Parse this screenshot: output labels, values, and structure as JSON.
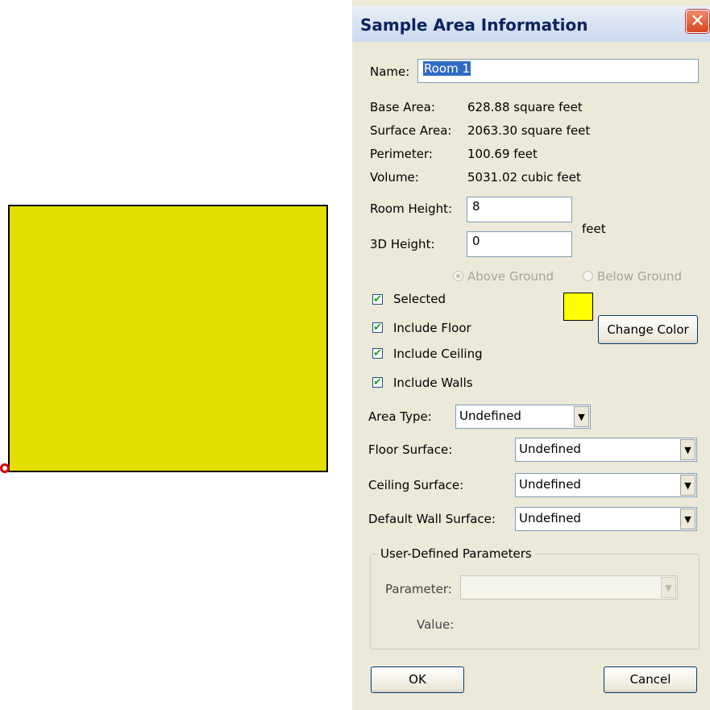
{
  "canvas": {
    "room_fill": "#e1de00",
    "handle_color": "#d40000"
  },
  "dialog": {
    "title": "Sample Area Information",
    "close_glyph": "✕",
    "name_label": "Name:",
    "name_value": "Room 1",
    "stats": [
      {
        "label": "Base Area:",
        "value": "628.88 square feet"
      },
      {
        "label": "Surface Area:",
        "value": "2063.30 square feet"
      },
      {
        "label": "Perimeter:",
        "value": "100.69 feet"
      },
      {
        "label": "Volume:",
        "value": "5031.02 cubic feet"
      }
    ],
    "room_height_label": "Room Height:",
    "room_height_value": "8",
    "height_3d_label": "3D Height:",
    "height_3d_value": "0",
    "height_unit": "feet",
    "above_ground": "Above Ground",
    "below_ground": "Below Ground",
    "checkboxes": {
      "selected": "Selected",
      "include_floor": "Include Floor",
      "include_ceiling": "Include Ceiling",
      "include_walls": "Include Walls",
      "check_glyph": "✔"
    },
    "swatch_color": "#ffff00",
    "change_color": "Change Color",
    "area_type_label": "Area Type:",
    "area_type_value": "Undefined",
    "floor_surface_label": "Floor Surface:",
    "floor_surface_value": "Undefined",
    "ceiling_surface_label": "Ceiling Surface:",
    "ceiling_surface_value": "Undefined",
    "wall_surface_label": "Default Wall Surface:",
    "wall_surface_value": "Undefined",
    "arrow_glyph": "▼",
    "group_title": "User-Defined Parameters",
    "parameter_label": "Parameter:",
    "parameter_value": "",
    "value_label": "Value:",
    "ok": "OK",
    "cancel": "Cancel"
  }
}
